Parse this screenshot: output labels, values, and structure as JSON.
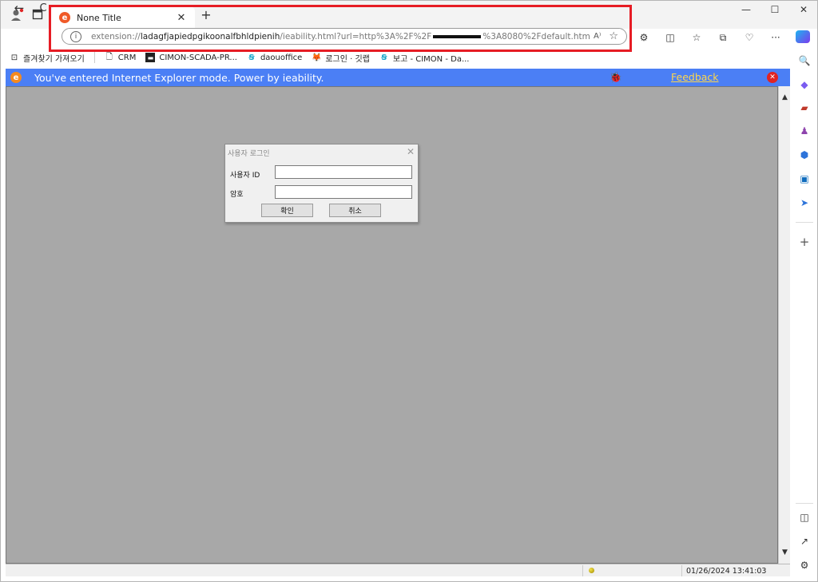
{
  "browser": {
    "tab": {
      "title": "None Title",
      "icon": "ie-icon",
      "close_glyph": "✕"
    },
    "new_tab_glyph": "+",
    "window_controls": {
      "minimize": "—",
      "maximize": "☐",
      "close": "✕"
    },
    "address_bar": {
      "url_prefix": "extension://",
      "url_host": "ladagfjapiedpgikoonalfbhldpienih",
      "url_path_before_redaction": "/ieability.html?url=http%3A%2F%2F",
      "url_path_after_redaction": "%3A8080%2Fdefault.htm",
      "info_glyph": "i",
      "read_aloud_glyph": "A⁾",
      "favorite_glyph": "☆"
    },
    "nav": {
      "back_glyph": "←",
      "reload_glyph": "C"
    },
    "toolbar_glyphs": {
      "extensions": "⚙",
      "split": "◫",
      "favorites": "☆",
      "collections": "⧉",
      "performance": "♡",
      "more": "···"
    }
  },
  "bookmarks": [
    {
      "label": "즐겨찾기 가져오기",
      "icon": "import-icon",
      "glyph": "⊡"
    },
    {
      "label": "CRM",
      "icon": "page-icon",
      "glyph": "🗋"
    },
    {
      "label": "CIMON-SCADA-PR...",
      "icon": "scada-icon",
      "glyph": "▬"
    },
    {
      "label": "daouoffice",
      "icon": "daou-icon",
      "glyph": "Ꞩ"
    },
    {
      "label": "로그인 · 깃랩",
      "icon": "gitlab-icon",
      "glyph": "🦊"
    },
    {
      "label": "보고 - CIMON - Da...",
      "icon": "daou-icon",
      "glyph": "Ꞩ"
    }
  ],
  "ie_bar": {
    "message": "You've entered Internet Explorer mode. Power by ieability.",
    "feedback": "Feedback",
    "logo_glyph": "e",
    "bug_glyph": "🐞",
    "close_glyph": "✕",
    "color": "#4b7ff5"
  },
  "login_dialog": {
    "title": "사용자 로그인",
    "close_glyph": "✕",
    "user_id_label": "사용자 ID",
    "password_label": "암호",
    "user_id_value": "",
    "password_value": "",
    "ok_label": "확인",
    "cancel_label": "취소"
  },
  "scrollbar": {
    "up_glyph": "▲",
    "down_glyph": "▼"
  },
  "status_bar": {
    "datetime": "01/26/2024 13:41:03"
  },
  "sidebar_icons": [
    "search-icon",
    "shopping-tag-icon",
    "toolbox-icon",
    "games-icon",
    "copilot-office-icon",
    "outlook-icon",
    "send-icon",
    "add-icon",
    "sidebar-toggle-icon",
    "external-open-icon",
    "settings-icon"
  ],
  "sidebar_glyphs": {
    "search": "🔍",
    "tag": "◆",
    "toolbox": "▰",
    "games": "♟",
    "office": "⬢",
    "outlook": "▣",
    "send": "➤",
    "add": "+",
    "toggle": "◫",
    "external": "↗",
    "settings": "⚙"
  },
  "highlight_color": "#e61c24",
  "content_background": "#a8a8a8"
}
